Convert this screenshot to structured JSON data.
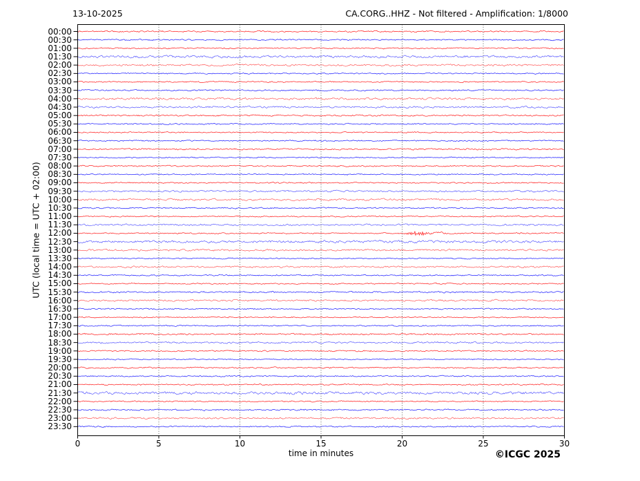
{
  "header": {
    "date": "13-10-2025",
    "title": "CA.CORG..HHZ - Not filtered - Amplification: 1/8000"
  },
  "axes": {
    "ylabel": "UTC (local time = UTC + 02:00)",
    "xlabel": "time in minutes",
    "x_ticks": [
      "0",
      "5",
      "10",
      "15",
      "20",
      "25",
      "30"
    ]
  },
  "footer": {
    "copyright": "©ICGC 2025"
  },
  "colors": {
    "trace_hour": "#ff0000",
    "trace_half_hour": "#0000ff",
    "grid": "#444444",
    "frame": "#000000",
    "text": "#000000",
    "background": "#ffffff"
  },
  "chart_data": {
    "type": "seismogram-helicorder",
    "station": "CA.CORG..HHZ",
    "filter": "Not filtered",
    "amplification": "1/8000",
    "date": "13-10-2025",
    "timezone_note": "UTC (local time = UTC + 02:00)",
    "x_range_minutes": [
      0,
      30
    ],
    "x_tick_interval_minutes": 5,
    "minutes_per_row": 30,
    "grid_vertical_dotted_minutes": [
      5,
      10,
      15,
      20,
      25
    ],
    "hour_row_color": "#ff0000",
    "half_hour_row_color": "#0000ff",
    "event": {
      "row": "12:00",
      "approx_minute": 21,
      "duration_minutes": 1.8,
      "relative_amplitude": 2.4,
      "description": "small wiggle visible on 12:00 trace near minute 21"
    },
    "rows": [
      {
        "label": "00:00",
        "amp": 1.1
      },
      {
        "label": "00:30",
        "amp": 1.0
      },
      {
        "label": "01:00",
        "amp": 0.9
      },
      {
        "label": "01:30",
        "amp": 2.0
      },
      {
        "label": "02:00",
        "amp": 1.5
      },
      {
        "label": "02:30",
        "amp": 0.9
      },
      {
        "label": "03:00",
        "amp": 1.0
      },
      {
        "label": "03:30",
        "amp": 1.1
      },
      {
        "label": "04:00",
        "amp": 1.7
      },
      {
        "label": "04:30",
        "amp": 1.5
      },
      {
        "label": "05:00",
        "amp": 1.1
      },
      {
        "label": "05:30",
        "amp": 1.0
      },
      {
        "label": "06:00",
        "amp": 0.9
      },
      {
        "label": "06:30",
        "amp": 1.0
      },
      {
        "label": "07:00",
        "amp": 1.2
      },
      {
        "label": "07:30",
        "amp": 0.9
      },
      {
        "label": "08:00",
        "amp": 1.0
      },
      {
        "label": "08:30",
        "amp": 0.9
      },
      {
        "label": "09:00",
        "amp": 1.0
      },
      {
        "label": "09:30",
        "amp": 1.4
      },
      {
        "label": "10:00",
        "amp": 1.6
      },
      {
        "label": "10:30",
        "amp": 1.0
      },
      {
        "label": "11:00",
        "amp": 0.9
      },
      {
        "label": "11:30",
        "amp": 1.4
      },
      {
        "label": "12:00",
        "amp": 1.0
      },
      {
        "label": "12:30",
        "amp": 2.0
      },
      {
        "label": "13:00",
        "amp": 1.5
      },
      {
        "label": "13:30",
        "amp": 0.9
      },
      {
        "label": "14:00",
        "amp": 1.4
      },
      {
        "label": "14:30",
        "amp": 1.0
      },
      {
        "label": "15:00",
        "amp": 0.9
      },
      {
        "label": "15:30",
        "amp": 1.2
      },
      {
        "label": "16:00",
        "amp": 1.4
      },
      {
        "label": "16:30",
        "amp": 1.0
      },
      {
        "label": "17:00",
        "amp": 0.9
      },
      {
        "label": "17:30",
        "amp": 1.0
      },
      {
        "label": "18:00",
        "amp": 1.2
      },
      {
        "label": "18:30",
        "amp": 1.4
      },
      {
        "label": "19:00",
        "amp": 1.0
      },
      {
        "label": "19:30",
        "amp": 0.9
      },
      {
        "label": "20:00",
        "amp": 1.1
      },
      {
        "label": "20:30",
        "amp": 1.0
      },
      {
        "label": "21:00",
        "amp": 1.0
      },
      {
        "label": "21:30",
        "amp": 2.2
      },
      {
        "label": "22:00",
        "amp": 1.0
      },
      {
        "label": "22:30",
        "amp": 1.1
      },
      {
        "label": "23:00",
        "amp": 1.4
      },
      {
        "label": "23:30",
        "amp": 1.0
      }
    ]
  }
}
